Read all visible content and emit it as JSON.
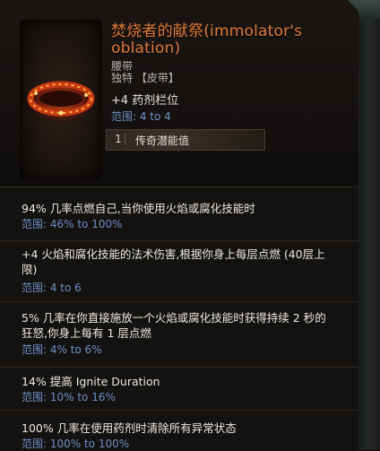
{
  "item": {
    "name": "焚烧者的献祭(immolator's oblation)",
    "slot": "腰带",
    "rarity_line": "独特 【皮带】",
    "main_stat": "+4 药剂栏位",
    "main_range": "范围: 4 to 4",
    "legendary_potential": {
      "value": "1",
      "label": "传奇潜能值"
    }
  },
  "stats": [
    {
      "text": "94% 几率点燃自己,当你使用火焰或腐化技能时",
      "range": "范围: 46% to 100%"
    },
    {
      "text": "+4 火焰和腐化技能的法术伤害,根据你身上每层点燃 (40层上限)",
      "range": "范围: 4 to 6"
    },
    {
      "text": "5% 几率在你直接施放一个火焰或腐化技能时获得持续 2 秒的狂怒,你身上每有 1 层点燃",
      "range": "范围: 4% to 6%"
    },
    {
      "text": "14% 提高 Ignite Duration",
      "range": "范围: 10% to 16%"
    },
    {
      "text": "100% 几率在使用药剂时清除所有异常状态",
      "range": "范围: 100% to 100%"
    }
  ],
  "colors": {
    "unique_name": "#e07a3c",
    "range": "#6d8fc4",
    "text": "#ece8e2"
  },
  "icons": {
    "item": "belt-icon",
    "ornament": "corner-ornament-icon"
  }
}
